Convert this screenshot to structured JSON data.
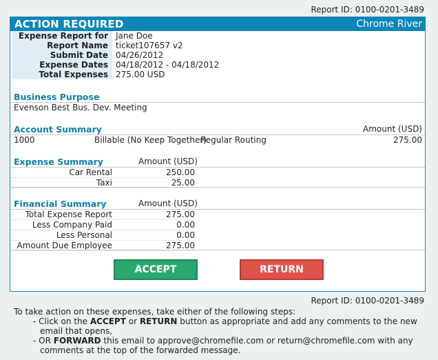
{
  "report_id_top": "Report ID: 0100-0201-3489",
  "report_id_bottom": "Report ID: 0100-0201-3489",
  "header": {
    "title": "ACTION REQUIRED",
    "brand": "Chrome River"
  },
  "summary": [
    {
      "label": "Expense Report for",
      "value": "Jane Doe"
    },
    {
      "label": "Report Name",
      "value": "ticket107657 v2"
    },
    {
      "label": "Submit Date",
      "value": "04/26/2012"
    },
    {
      "label": "Expense Dates",
      "value": "04/18/2012 - 04/18/2012"
    },
    {
      "label": "Total Expenses",
      "value": "275.00 USD"
    }
  ],
  "business_purpose": {
    "title": "Business Purpose",
    "text": "Evenson Best Bus. Dev. Meeting"
  },
  "account_summary": {
    "title": "Account Summary",
    "amount_header": "Amount (USD)",
    "row": {
      "account": "1000",
      "type": "Billable (No Keep Together)",
      "routing": "Regular Routing",
      "amount": "275.00"
    }
  },
  "expense_summary": {
    "title": "Expense Summary",
    "amount_header": "Amount (USD)",
    "rows": [
      {
        "label": "Car Rental",
        "amount": "250.00"
      },
      {
        "label": "Taxi",
        "amount": "25.00"
      }
    ]
  },
  "financial_summary": {
    "title": "Financial Summary",
    "amount_header": "Amount (USD)",
    "rows": [
      {
        "label": "Total Expense Report",
        "amount": "275.00"
      },
      {
        "label": "Less Company Paid",
        "amount": "0.00"
      },
      {
        "label": "Less Personal",
        "amount": "0.00"
      },
      {
        "label": "Amount Due Employee",
        "amount": "275.00"
      }
    ]
  },
  "buttons": {
    "accept": "ACCEPT",
    "return": "RETURN"
  },
  "instructions": {
    "intro": "To take action on these expenses, take either of the following steps:",
    "step1_pre": "- Click on the ",
    "step1_accept": "ACCEPT",
    "step1_or": " or ",
    "step1_return": "RETURN",
    "step1_post": " button as appropriate and add any comments to the new email that opens,",
    "step2_pre": "- OR ",
    "step2_forward": "FORWARD",
    "step2_post": " this email to approve@chromefile.com or return@chromefile.com with any comments at the top of the forwarded message."
  }
}
